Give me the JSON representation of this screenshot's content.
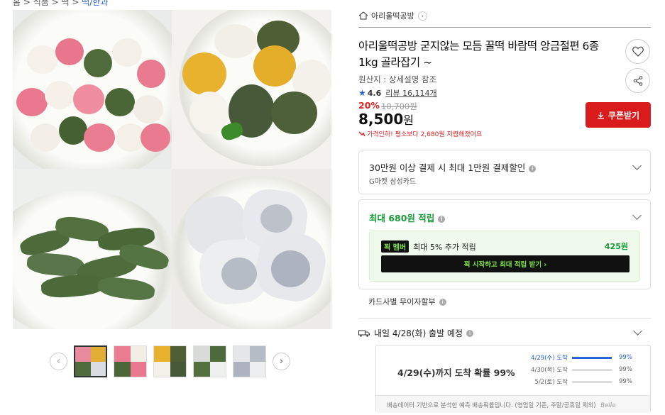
{
  "breadcrumb": {
    "left": "홈 > 식품 > 떡 > ",
    "link": "떡/한과"
  },
  "store": {
    "name": "아리울떡공방"
  },
  "product": {
    "title": "아리울떡공방 굳지않는 모듬 꿀떡 바람떡 앙금절편 6종 1kg 골라잡기 ~",
    "origin": "원산지 : 상세설명 참조",
    "rating": "4.6",
    "review_label": "리뷰 16,114개",
    "discount": "20%",
    "original_price": "10,700원",
    "price": "8,500",
    "price_unit": "원",
    "lowest_note": "가격인하! 평소보다 2,680원 저렴해졌어요"
  },
  "buttons": {
    "coupon": "쿠폰받기"
  },
  "payment_box": {
    "title": "30만원 이상 결제 시 최대 1만원 결제할인",
    "sub": "G마켓 삼성카드"
  },
  "points_box": {
    "title": "최대 680원 적립",
    "member_badge": "꾁 멤버",
    "member_text": "최대 5% 추가 적립",
    "member_amount": "425원",
    "cta": "꾁 시작하고 최대 적립 받기 ›"
  },
  "card_installment": "카드사별 무이자할부",
  "shipping": {
    "title": "내일 4/28(화) 출발 예정",
    "headline": "4/29(수)까지 도착 확률 99%",
    "rows": [
      {
        "date": "4/29(수) 도착",
        "pct": "99%",
        "fill": 1.0
      },
      {
        "date": "4/30(목) 도착",
        "pct": "99%",
        "fill": 0.0
      },
      {
        "date": "5/2(토) 도착",
        "pct": "99%",
        "fill": 0.0
      }
    ],
    "footer": "배송데이터 기반으로 분석한 예측 배송확률입니다. (영업일 기준, 주말/공휴일 제외)",
    "brand": "Bello"
  },
  "icons": [
    "home-icon",
    "chevron-right-icon",
    "heart-icon",
    "share-icon",
    "star-icon",
    "download-icon",
    "info-icon",
    "chevron-down-icon",
    "truck-icon",
    "arrow-left-icon",
    "arrow-right-icon"
  ],
  "colors": {
    "accent_red": "#d91b1b",
    "discount_red": "#e52222",
    "green": "#1a9a3a",
    "blue": "#2b64d8"
  }
}
